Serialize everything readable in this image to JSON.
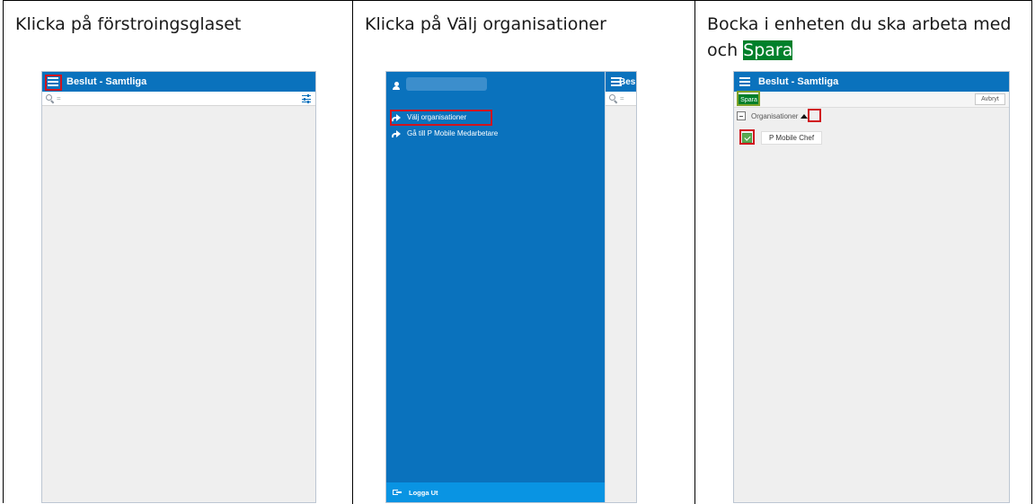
{
  "captions": {
    "step1": "Klicka på förstroingsglaset",
    "step2": "Klicka på Välj organisationer",
    "step3_pre": "Bocka i enheten du ska arbeta med och ",
    "step3_highlight": "Spara"
  },
  "screen1": {
    "title": "Beslut - Samtliga",
    "search_placeholder": "="
  },
  "screen2": {
    "menu_items": [
      "Välj organisationer",
      "Gå till P Mobile Medarbetare"
    ],
    "logout": "Logga Ut",
    "peek_title": "Beslut -",
    "search_placeholder": "="
  },
  "screen3": {
    "title": "Beslut - Samtliga",
    "save_button": "Spara",
    "cancel_button": "Avbryt",
    "tree_label": "Organisationer",
    "org_item": "P Mobile Chef"
  },
  "colors": {
    "brand_blue": "#0a72bd",
    "save_green": "#00802b",
    "highlight_red": "#d0141d"
  }
}
